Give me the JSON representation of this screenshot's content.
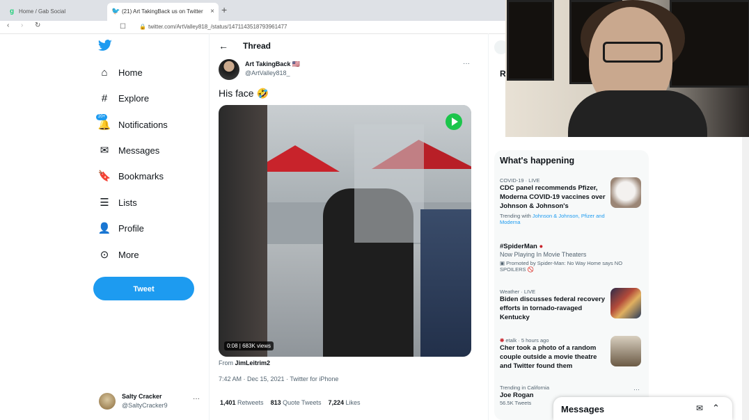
{
  "browser": {
    "tabs": [
      {
        "title": "Home / Gab Social"
      },
      {
        "title": "(21) Art TakingBack us on Twitter"
      }
    ],
    "new_tab": "+",
    "tab_close": "×",
    "url": "twitter.com/ArtValley818_/status/1471143518793961477"
  },
  "sidebar": {
    "items": [
      {
        "label": "Home",
        "icon": "home-icon"
      },
      {
        "label": "Explore",
        "icon": "hashtag-icon"
      },
      {
        "label": "Notifications",
        "icon": "bell-icon",
        "badge": "20+"
      },
      {
        "label": "Messages",
        "icon": "envelope-icon"
      },
      {
        "label": "Bookmarks",
        "icon": "bookmark-icon"
      },
      {
        "label": "Lists",
        "icon": "list-icon"
      },
      {
        "label": "Profile",
        "icon": "person-icon"
      },
      {
        "label": "More",
        "icon": "more-circle-icon"
      }
    ],
    "tweet_button": "Tweet",
    "account": {
      "name": "Salty Cracker",
      "handle": "@SaltyCracker9",
      "more": "···"
    }
  },
  "thread": {
    "title": "Thread",
    "author": {
      "name": "Art TakingBack 🇺🇸",
      "handle": "@ArtValley818_"
    },
    "more": "···",
    "text": "His face 🤣",
    "video": {
      "duration": "0:08",
      "views": "683K views"
    },
    "from_label": "From ",
    "from_user": "JimLeitrim2",
    "timestamp": "7:42 AM · Dec 15, 2021 · Twitter for iPhone",
    "stats": {
      "retweets": "1,401",
      "retweets_label": " Retweets",
      "quotes": "813",
      "quotes_label": " Quote Tweets",
      "likes": "7,224",
      "likes_label": " Likes"
    }
  },
  "right": {
    "peek_letter": "R",
    "happening_title": "What's happening",
    "trends": [
      {
        "meta": "COVID-19 · LIVE",
        "title": "CDC panel recommends Pfizer, Moderna COVID-19 vaccines over Johnson & Johnson's",
        "extra": "Trending with ",
        "links": "Johnson & Johnson, Pfizer and Moderna"
      },
      {
        "title": "#SpiderMan",
        "sub": "Now Playing In Movie Theaters",
        "promo": "Promoted by Spider-Man: No Way Home says NO SPOILERS 🚫"
      },
      {
        "meta": "Weather · LIVE",
        "title": "Biden discusses federal recovery efforts in tornado-ravaged Kentucky"
      },
      {
        "meta": "etalk · 5 hours ago",
        "title": "Cher took a photo of a random couple outside a movie theatre and Twitter found them"
      },
      {
        "meta": "Trending in California",
        "title": "Joe Rogan",
        "sub": "56.5K Tweets"
      }
    ]
  },
  "messages_drawer": {
    "title": "Messages"
  },
  "colors": {
    "accent": "#1d9bf0",
    "text": "#0f1419",
    "muted": "#536471"
  }
}
